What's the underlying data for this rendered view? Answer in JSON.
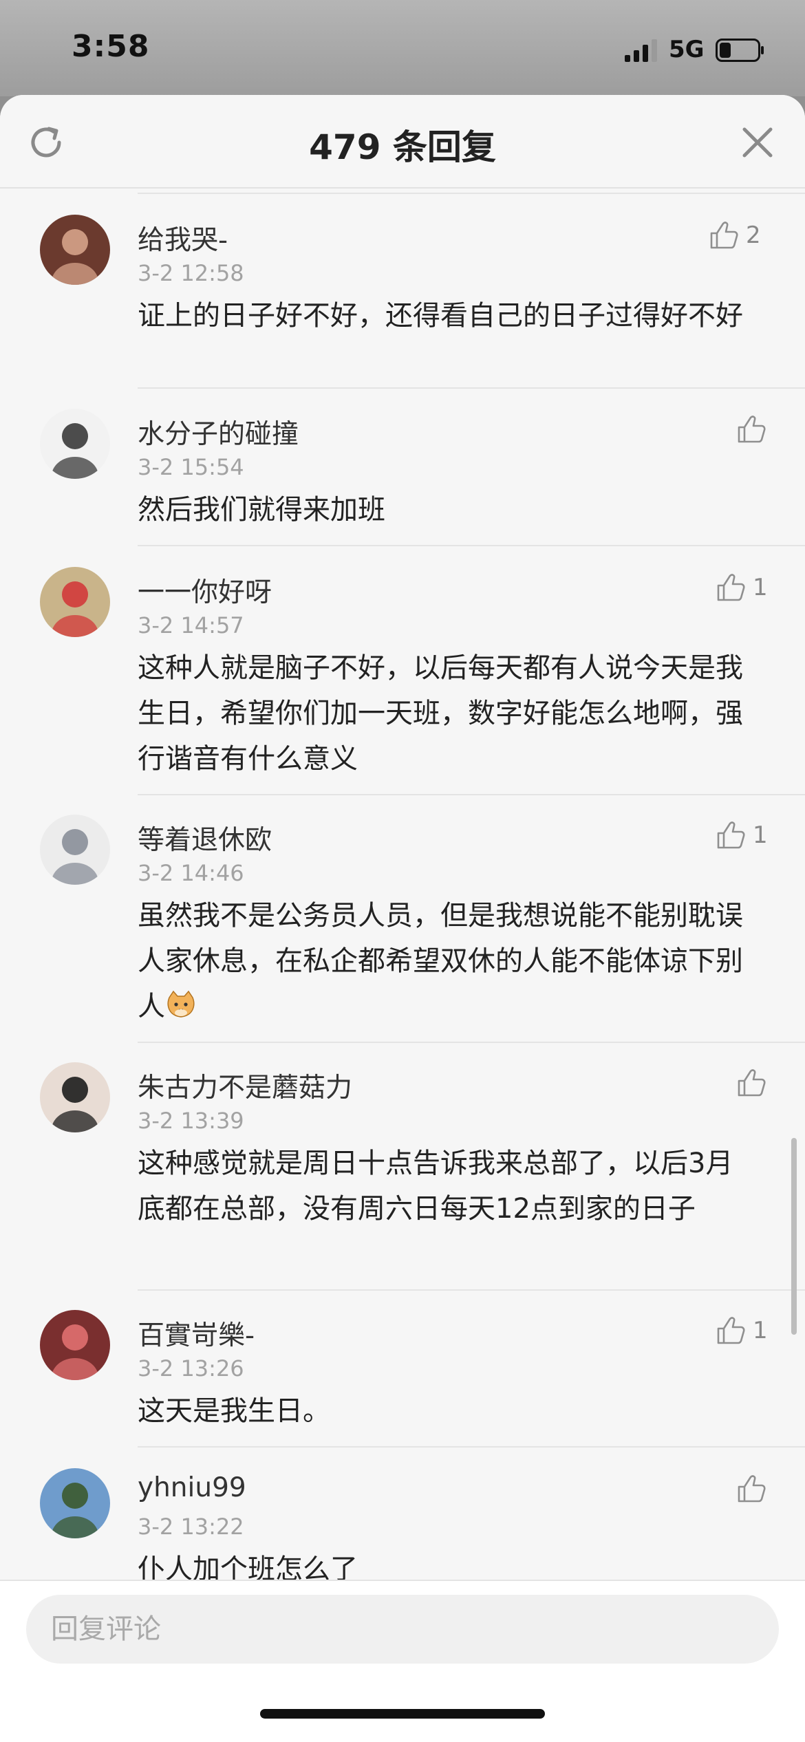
{
  "status_bar": {
    "time": "3:58",
    "network": "5G",
    "signal_icon": "signal-bars-icon",
    "battery_icon": "battery-low-icon"
  },
  "header": {
    "title": "479 条回复",
    "refresh_icon": "refresh-icon",
    "close_icon": "close-icon"
  },
  "comments": [
    {
      "name": "给我哭-",
      "time": "3-2 12:58",
      "text": "证上的日子好不好，还得看自己的日子过得好不好",
      "likes": "2",
      "avatar_colors": [
        "#6b3a2e",
        "#d6a38a"
      ]
    },
    {
      "name": "水分子的碰撞",
      "time": "3-2 15:54",
      "text": "然后我们就得来加班",
      "likes": "",
      "avatar_colors": [
        "#f2f2f2",
        "#3a3a3a"
      ]
    },
    {
      "name": "一一你好呀",
      "time": "3-2 14:57",
      "text": "这种人就是脑子不好，以后每天都有人说今天是我生日，希望你们加一天班，数字好能怎么地啊，强行谐音有什么意义",
      "likes": "1",
      "avatar_colors": [
        "#c9b48a",
        "#d23a3a"
      ]
    },
    {
      "name": "等着退休欧",
      "time": "3-2 14:46",
      "text": "虽然我不是公务员人员，但是我想说能不能别耽误人家休息，在私企都希望双休的人能不能体谅下别人",
      "likes": "1",
      "avatar_colors": [
        "#ececec",
        "#8a8f99"
      ],
      "emoji_icon": "cat-face-emoji-icon"
    },
    {
      "name": "朱古力不是蘑菇力",
      "time": "3-2 13:39",
      "text": "这种感觉就是周日十点告诉我来总部了，以后3月底都在总部，没有周六日每天12点到家的日子",
      "likes": "",
      "avatar_colors": [
        "#e8dcd4",
        "#1d1d1d"
      ]
    },
    {
      "name": "百實岢樂-",
      "time": "3-2 13:26",
      "text": "这天是我生日。",
      "likes": "1",
      "avatar_colors": [
        "#7a2f2f",
        "#e07070"
      ]
    },
    {
      "name": "yhniu99",
      "time": "3-2 13:22",
      "text": "仆人加个班怎么了",
      "likes": "",
      "avatar_colors": [
        "#6f9ccc",
        "#3b5a2e"
      ]
    }
  ],
  "reply": {
    "placeholder": "回复评论"
  }
}
